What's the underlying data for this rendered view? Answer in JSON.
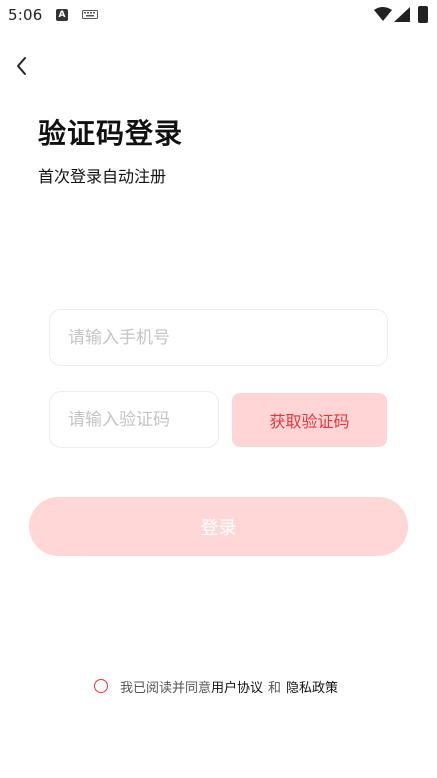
{
  "status_bar": {
    "time": "5:06",
    "notification_icon_letter": "A"
  },
  "header": {
    "back_icon": "chevron-left-icon"
  },
  "main": {
    "title": "验证码登录",
    "subtitle": "首次登录自动注册",
    "phone_placeholder": "请输入手机号",
    "phone_value": "",
    "code_placeholder": "请输入验证码",
    "code_value": "",
    "get_code_label": "获取验证码",
    "login_label": "登录"
  },
  "agreement": {
    "checked": false,
    "prefix": "我已阅读并同意",
    "user_agreement": "用户协议",
    "and": "和",
    "privacy_policy": "隐私政策"
  },
  "colors": {
    "accent": "#e5383b",
    "button_bg": "#ffd5d5",
    "login_bg": "#ffd7d7",
    "border": "#ececec",
    "placeholder": "#c4c4c4"
  }
}
